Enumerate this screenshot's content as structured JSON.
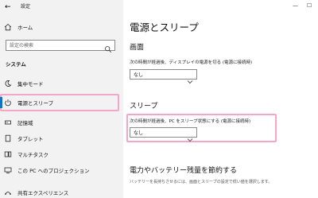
{
  "window": {
    "app_title": "設定",
    "minimize": "—",
    "maximize": "☐"
  },
  "nav": {
    "home_label": "ホーム",
    "search_placeholder": "設定の検索",
    "section": "システム",
    "items": [
      {
        "label": "集中モード",
        "icon": "moon-icon"
      },
      {
        "label": "電源とスリープ",
        "icon": "power-icon",
        "selected": true
      },
      {
        "label": "記憶域",
        "icon": "storage-icon"
      },
      {
        "label": "タブレット",
        "icon": "tablet-icon"
      },
      {
        "label": "マルチタスク",
        "icon": "multitask-icon"
      },
      {
        "label": "この PC へのプロジェクション",
        "icon": "projection-icon"
      },
      {
        "label": "共有エクスペリエンス",
        "icon": "shared-icon"
      }
    ]
  },
  "main": {
    "title": "電源とスリープ",
    "screen": {
      "heading": "画面",
      "desc": "次の時間が経過後、ディスプレイの電源を切る (電源に接続時)",
      "value": "なし"
    },
    "sleep": {
      "heading": "スリープ",
      "desc": "次の時間が経過後、PC をスリープ状態にする (電源に接続時)",
      "value": "なし"
    },
    "battery": {
      "heading": "電力やバッテリー残量を節約する",
      "desc": "バッテリーを長持ちさせるには、画面とスリープの設定で低い値を選択します。"
    }
  },
  "colors": {
    "nav_bg": "#f2f2f2",
    "highlight": "#f4a6c8",
    "accent": "#0078d7"
  }
}
